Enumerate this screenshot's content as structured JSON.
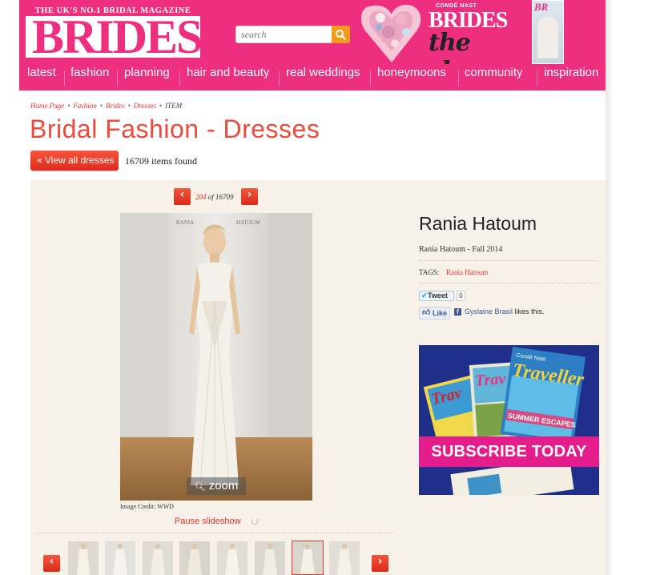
{
  "header": {
    "logo_text": "BRIDES",
    "logo_tagline": "THE UK'S NO.1 BRIDAL MAGAZINE",
    "search_placeholder": "search",
    "show_banner_brand": "CONDÉ NAST",
    "show_banner_title": "BRIDES",
    "show_banner_subtitle": "the show"
  },
  "nav": {
    "items": [
      "latest",
      "fashion",
      "planning",
      "hair and beauty",
      "real weddings",
      "honeymoons",
      "community",
      "inspiration"
    ]
  },
  "breadcrumb": {
    "items": [
      "Home Page",
      "Fashion",
      "Brides",
      "Dresses"
    ],
    "current": "ITEM"
  },
  "page": {
    "title": "Bridal Fashion - Dresses",
    "view_all_label": "« View all dresses",
    "items_found": "16709 items found"
  },
  "pager": {
    "current": "204",
    "of_label": "of 16709"
  },
  "image": {
    "zoom_label": "zoom",
    "credit": "Image Credit: WWD",
    "pause_label": "Pause slideshow"
  },
  "item": {
    "designer": "Rania Hatoum",
    "collection": "Rania Hatoum - Fall 2014",
    "tags_label": "TAGS:",
    "tag": "Rania Hatoum"
  },
  "social": {
    "tweet_label": "Tweet",
    "tweet_count": "0",
    "like_label": "Like",
    "fb_name": "Gyslaine Brasil",
    "fb_suffix": " likes this."
  },
  "ad": {
    "subscribe_label": "SUBSCRIBE TODAY",
    "mag_title": "Traveller",
    "mag_brand": "Condé Nast",
    "mag_headline": "SUMMER ESCAPES"
  },
  "colors": {
    "brand_pink": "#ee2f7f",
    "accent_red": "#e8322e",
    "panel_bg": "#f7f1ea"
  }
}
